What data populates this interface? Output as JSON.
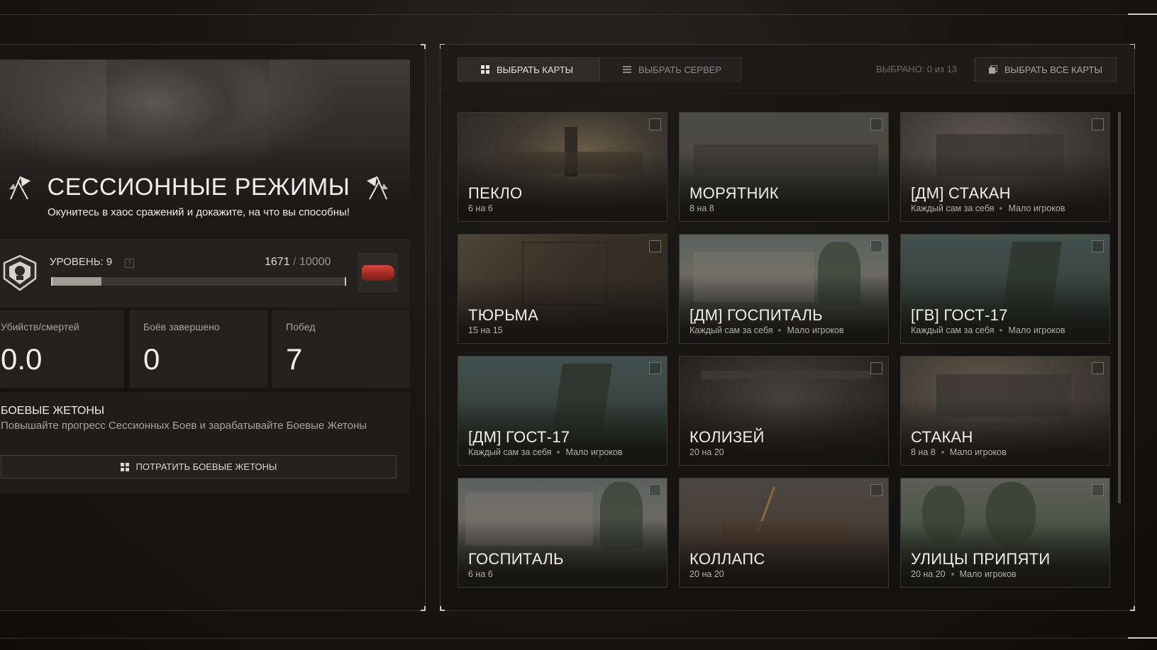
{
  "left": {
    "hero": {
      "title": "СЕССИОННЫЕ РЕЖИМЫ",
      "subtitle": "Окунитесь в хаос сражений и докажите, на что вы способны!"
    },
    "level": {
      "label": "УРОВЕНЬ: 9",
      "help": "?",
      "xp_current": "1671",
      "xp_sep": "/",
      "xp_max": "10000",
      "progress_fraction": 0.167
    },
    "stats": [
      {
        "label": "Убийств/смертей",
        "value": "0.0"
      },
      {
        "label": "Боёв завершено",
        "value": "0"
      },
      {
        "label": "Побед",
        "value": "7"
      }
    ],
    "tokens": {
      "title": "БОЕВЫЕ ЖЕТОНЫ",
      "description": "Повышайте прогресс Сессионных Боев и зарабатывайте Боевые Жетоны",
      "button": "ПОТРАТИТЬ БОЕВЫЕ ЖЕТОНЫ"
    }
  },
  "right": {
    "tabs": [
      {
        "label": "ВЫБРАТЬ КАРТЫ",
        "icon": "grid-icon",
        "active": true
      },
      {
        "label": "ВЫБРАТЬ СЕРВЕР",
        "icon": "list-icon",
        "active": false
      }
    ],
    "selected_count": "ВЫБРАНО: 0 из 13",
    "select_all": "ВЫБРАТЬ ВСЕ КАРТЫ",
    "maps": [
      {
        "name": "ПЕКЛО",
        "meta": [
          "6 на 6"
        ],
        "checked": false
      },
      {
        "name": "МОРЯТНИК",
        "meta": [
          "8 на 8"
        ],
        "checked": false
      },
      {
        "name": "[ДМ] СТАКАН",
        "meta": [
          "Каждый сам за себя",
          "Мало игроков"
        ],
        "checked": false
      },
      {
        "name": "ТЮРЬМА",
        "meta": [
          "15 на 15"
        ],
        "checked": false
      },
      {
        "name": "[ДМ] ГОСПИТАЛЬ",
        "meta": [
          "Каждый сам за себя",
          "Мало игроков"
        ],
        "checked": false
      },
      {
        "name": "[ГВ] ГОСТ-17",
        "meta": [
          "Каждый сам за себя",
          "Мало игроков"
        ],
        "checked": false
      },
      {
        "name": "[ДМ] ГОСТ-17",
        "meta": [
          "Каждый сам за себя",
          "Мало игроков"
        ],
        "checked": false
      },
      {
        "name": "КОЛИЗЕЙ",
        "meta": [
          "20 на 20"
        ],
        "checked": false
      },
      {
        "name": "СТАКАН",
        "meta": [
          "8 на 8",
          "Мало игроков"
        ],
        "checked": false
      },
      {
        "name": "ГОСПИТАЛЬ",
        "meta": [
          "6 на 6"
        ],
        "checked": false
      },
      {
        "name": "КОЛЛАПС",
        "meta": [
          "20 на 20"
        ],
        "checked": false
      },
      {
        "name": "УЛИЦЫ ПРИПЯТИ",
        "meta": [
          "20 на 20",
          "Мало игроков"
        ],
        "checked": false
      }
    ]
  }
}
